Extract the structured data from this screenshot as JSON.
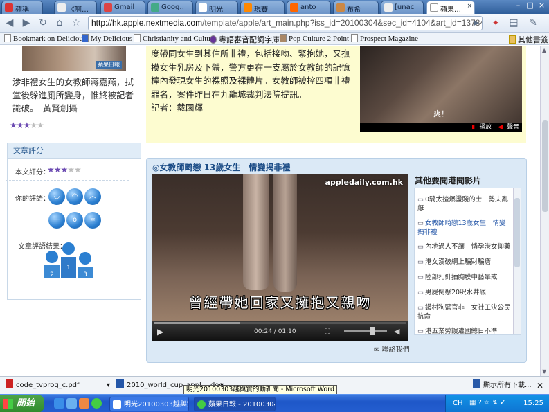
{
  "browser": {
    "tabs": [
      {
        "label": "蘋稱",
        "color": "#d33"
      },
      {
        "label": "《啊…",
        "color": "#eee"
      },
      {
        "label": "Gmail",
        "color": "#d44"
      },
      {
        "label": "Goog…",
        "color": "#4a8"
      },
      {
        "label": "明光",
        "color": "#fff"
      },
      {
        "label": "現賽",
        "color": "#f80"
      },
      {
        "label": "anto",
        "color": "#f60"
      },
      {
        "label": "布希",
        "color": "#c84"
      },
      {
        "label": "[unac…",
        "color": "#eee"
      },
      {
        "label": "蘋果…",
        "color": "#fff"
      }
    ],
    "tab_close": "×",
    "url_host": "http://hk.apple.nextmedia.com",
    "url_path": "/template/apple/art_main.php?iss_id=20100304&sec_id=4104&art_id=13784459",
    "bookmarks": [
      "Bookmark on Delicious",
      "My Delicious",
      "Christianity and Culture",
      "粵語審音配詞字庫",
      "Pop Culture 2 Point 0",
      "Prospect Magazine"
    ],
    "other_bookmarks": "其他書簽"
  },
  "left": {
    "photo_tag": "蘋果日報",
    "caption": "涉非禮女生的女教師蔣嘉燕，拭堂後躲進廁所變身，惟終被記者識破。　黃賢創攝",
    "stars_on": "★★★",
    "stars_off": "★★",
    "rating_header": "文章評分",
    "article_rating_label": "本文評分：",
    "your_rating_label": "你的評語：",
    "result_label": "文章評語結果：",
    "podium": [
      "2",
      "1",
      "3"
    ]
  },
  "article": {
    "text": "度帶同女生到其住所非禮，包括接吻、緊抱她，又撫摸女生乳房及下體，警方更在一支屬於女教師的記憶棒內發現女生的裸照及裸體片。女教師被控四項非禮罪名，案件昨日在九龍城裁判法院提訊。",
    "reporter": "記者：戴國輝",
    "top_video_caption": "爽！",
    "top_video_play": "播放",
    "top_video_sound": "聲音"
  },
  "video": {
    "title": "◎女教師畸戀 13歲女生　情變揭非禮",
    "watermark": "appledaily.com.hk",
    "subtitle": "曾經帶她回家又擁抱又親吻",
    "time": "00:24 / 01:10",
    "progress": 0.34,
    "contact": "聯絡我們"
  },
  "hot": {
    "title": "其他要聞港聞影片",
    "items": [
      "0騎太揸爆盪賤的士　勢夫亂艇",
      "女教師畸戀13歲女生　情變揭非禮",
      "內地過人不讓　憐孕港女仰藥",
      "港女漢破網上騙財騙瘡",
      "陸部扎針抽胸膜中藝暈戒",
      "男屍倒懸20呎水井底",
      "鑽村狗藍官非　女社工決公民抗命",
      "港五業勞誤遭國總日不準"
    ]
  },
  "downloads": [
    {
      "name": "code_tvprog_c.pdf"
    },
    {
      "name": "2010_world_cup_appl….doc"
    }
  ],
  "tooltip": "明光20100303越與實的動新聞 - Microsoft Word",
  "show_all": "顯示所有下載...",
  "taskbar": {
    "start": "開始",
    "tasks": [
      "明光20100303越與實...",
      "蘋果日報 - 20100304..."
    ],
    "lang": "CH",
    "clock": "15:25"
  }
}
